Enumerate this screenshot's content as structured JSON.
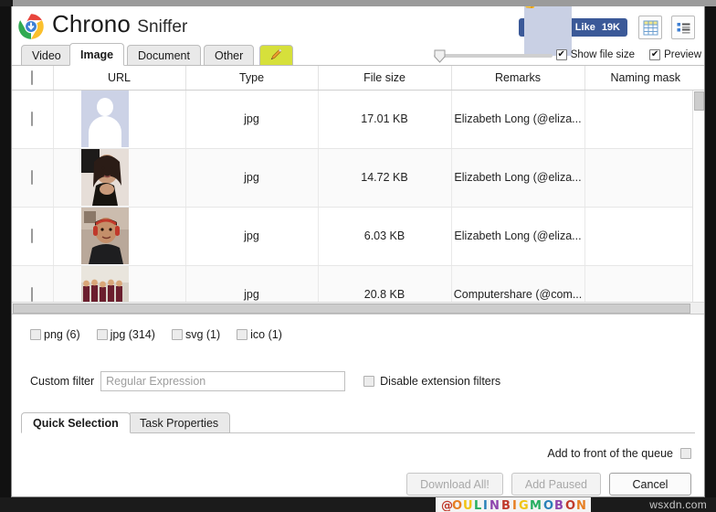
{
  "app": {
    "title_strong": "Chrono",
    "title_light": "Sniffer",
    "logo_icon": "chrome-download-icon"
  },
  "header": {
    "like": {
      "label": "Like",
      "count": "19K",
      "icon": "thumbs-up-icon",
      "color": "#3b5998"
    },
    "view_grid_icon": "grid-view-icon",
    "view_list_icon": "list-view-icon",
    "show_file_size": {
      "label": "Show file size",
      "checked": true
    },
    "preview": {
      "label": "Preview",
      "checked": true
    },
    "zoom_slider": {
      "value": 0,
      "min": 0,
      "max": 100
    }
  },
  "tabs": [
    {
      "label": "Video",
      "active": false
    },
    {
      "label": "Image",
      "active": true
    },
    {
      "label": "Document",
      "active": false
    },
    {
      "label": "Other",
      "active": false
    },
    {
      "label": "",
      "active": false,
      "icon": "pencil-icon",
      "color": "#d6e03b"
    }
  ],
  "table": {
    "columns": [
      "",
      "URL",
      "Type",
      "File size",
      "Remarks",
      "Naming mask"
    ],
    "rows": [
      {
        "checked": false,
        "thumb": "avatar-placeholder",
        "type": "jpg",
        "size": "17.01 KB",
        "remarks": "Elizabeth Long (@eliza...",
        "mask": ""
      },
      {
        "checked": false,
        "thumb": "portrait-woman",
        "type": "jpg",
        "size": "14.72 KB",
        "remarks": "Elizabeth Long (@eliza...",
        "mask": ""
      },
      {
        "checked": false,
        "thumb": "portrait-man-headset",
        "type": "jpg",
        "size": "6.03 KB",
        "remarks": "Elizabeth Long (@eliza...",
        "mask": ""
      },
      {
        "checked": false,
        "thumb": "group-photo",
        "type": "jpg",
        "size": "20.8 KB",
        "remarks": "Computershare (@com...",
        "mask": ""
      }
    ]
  },
  "filters": {
    "extensions": [
      {
        "label": "png (6)",
        "checked": false
      },
      {
        "label": "jpg (314)",
        "checked": false
      },
      {
        "label": "svg (1)",
        "checked": false
      },
      {
        "label": "ico (1)",
        "checked": false
      }
    ],
    "custom_filter_label": "Custom filter",
    "custom_filter_value": "",
    "custom_filter_placeholder": "Regular Expression",
    "disable_extension_filters": {
      "label": "Disable extension filters",
      "checked": false
    }
  },
  "bottom_tabs": [
    {
      "label": "Quick Selection",
      "active": true
    },
    {
      "label": "Task Properties",
      "active": false
    }
  ],
  "footer": {
    "queue_label": "Add to front of the queue",
    "queue_checked": false,
    "buttons": [
      {
        "label": "Download All!",
        "enabled": false
      },
      {
        "label": "Add Paused",
        "enabled": false
      },
      {
        "label": "Cancel",
        "enabled": true
      }
    ]
  },
  "overlay": {
    "watermark": "wsxdn.com"
  }
}
